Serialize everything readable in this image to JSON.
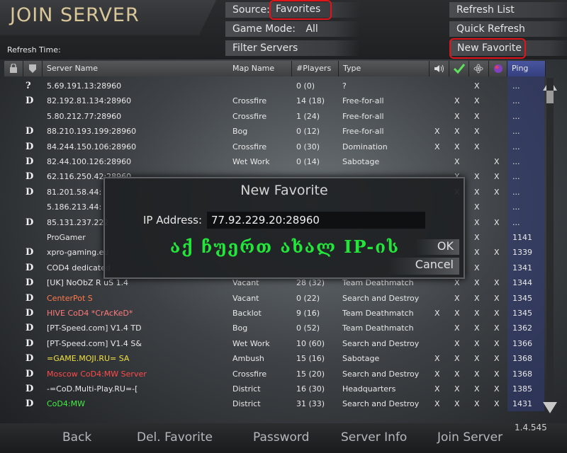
{
  "header": {
    "title": "JOIN SERVER",
    "source_label": "Source:",
    "source_value": "Favorites",
    "game_mode_label": "Game Mode:",
    "game_mode_value": "All",
    "filter_servers": "Filter Servers",
    "refresh_time": "Refresh Time:",
    "refresh_list": "Refresh List",
    "quick_refresh": "Quick Refresh",
    "new_favorite": "New Favorite"
  },
  "columns": {
    "server_name": "Server Name",
    "map_name": "Map Name",
    "players": "#Players",
    "type": "Type",
    "ping": "Ping"
  },
  "rows": [
    {
      "icon": "?",
      "name": "5.69.191.13:28960",
      "map": "",
      "players": "0 (0)",
      "type": "?",
      "c1": "",
      "c2": "",
      "c3": "X",
      "c4": "",
      "ping": "...",
      "color": "#e8e8e8"
    },
    {
      "icon": "D",
      "name": "82.192.81.134:28960",
      "map": "Crossfire",
      "players": "14 (18)",
      "type": "Free-for-all",
      "c1": "",
      "c2": "X",
      "c3": "X",
      "c4": "",
      "ping": "...",
      "color": "#e8e8e8"
    },
    {
      "icon": "",
      "name": "5.80.212.77:28960",
      "map": "Crossfire",
      "players": "1 (24)",
      "type": "Free-for-all",
      "c1": "",
      "c2": "X",
      "c3": "X",
      "c4": "",
      "ping": "...",
      "color": "#e8e8e8"
    },
    {
      "icon": "D",
      "name": "88.210.193.199:28960",
      "map": "Bog",
      "players": "0 (12)",
      "type": "Free-for-all",
      "c1": "X",
      "c2": "X",
      "c3": "X",
      "c4": "",
      "ping": "...",
      "color": "#e8e8e8"
    },
    {
      "icon": "D",
      "name": "84.244.150.106:28960",
      "map": "Crossfire",
      "players": "0 (30)",
      "type": "Domination",
      "c1": "X",
      "c2": "X",
      "c3": "X",
      "c4": "",
      "ping": "...",
      "color": "#e8e8e8"
    },
    {
      "icon": "D",
      "name": "82.44.100.126:28960",
      "map": "Wet Work",
      "players": "0 (14)",
      "type": "Sabotage",
      "c1": "",
      "c2": "X",
      "c3": "",
      "c4": "X",
      "ping": "...",
      "color": "#e8e8e8"
    },
    {
      "icon": "D",
      "name": "62.116.250.42:28960",
      "map": "",
      "players": "",
      "type": "",
      "c1": "",
      "c2": "X",
      "c3": "X",
      "c4": "X",
      "ping": "...",
      "color": "#e8e8e8"
    },
    {
      "icon": "D",
      "name": "81.201.58.44:",
      "map": "",
      "players": "",
      "type": "",
      "c1": "",
      "c2": "X",
      "c3": "X",
      "c4": "X",
      "ping": "...",
      "color": "#e8e8e8"
    },
    {
      "icon": "",
      "name": "5.186.213.44:",
      "map": "",
      "players": "",
      "type": "",
      "c1": "",
      "c2": "",
      "c3": "X",
      "c4": "",
      "ping": "...",
      "color": "#e8e8e8"
    },
    {
      "icon": "D",
      "name": "85.131.237.222",
      "map": "",
      "players": "",
      "type": "",
      "c1": "",
      "c2": "",
      "c3": "X",
      "c4": "X",
      "ping": "...",
      "color": "#e8e8e8"
    },
    {
      "icon": "",
      "name": "ProGamer",
      "map": "",
      "players": "",
      "type": "",
      "c1": "",
      "c2": "",
      "c3": "X",
      "c4": "",
      "ping": "1141",
      "color": "#e8e8e8"
    },
    {
      "icon": "D",
      "name": "xpro-gaming.eu",
      "map": "",
      "players": "",
      "type": "",
      "c1": "",
      "c2": "",
      "c3": "X",
      "c4": "X",
      "ping": "1339",
      "color": "#e8e8e8"
    },
    {
      "icon": "D",
      "name": "COD4 dedicated",
      "map": "",
      "players": "",
      "type": "",
      "c1": "",
      "c2": "",
      "c3": "X",
      "c4": "",
      "ping": "1341",
      "color": "#e8e8e8"
    },
    {
      "icon": "D",
      "name": "[UK] NoObZ R uS 1.4",
      "map": "Vacant",
      "players": "28 (32)",
      "type": "Team Deathmatch",
      "c1": "",
      "c2": "X",
      "c3": "X",
      "c4": "X",
      "ping": "1344",
      "color": "#e8e8e8"
    },
    {
      "icon": "D",
      "name": "CenterPot S",
      "map": "Vacant",
      "players": "0 (22)",
      "type": "Search and Destroy",
      "c1": "",
      "c2": "X",
      "c3": "X",
      "c4": "X",
      "ping": "1345",
      "color": "#ff7a4a"
    },
    {
      "icon": "D",
      "name": "HIVE CoD4 *CrAcKeD*",
      "map": "Backlot",
      "players": "9 (16)",
      "type": "Team Deathmatch",
      "c1": "X",
      "c2": "X",
      "c3": "X",
      "c4": "X",
      "ping": "1345",
      "color": "#ff7a7a"
    },
    {
      "icon": "D",
      "name": "[PT-Speed.com] V1.4 TD",
      "map": "Bog",
      "players": "0 (52)",
      "type": "Team Deathmatch",
      "c1": "",
      "c2": "X",
      "c3": "X",
      "c4": "X",
      "ping": "1362",
      "color": "#e8e8e8"
    },
    {
      "icon": "D",
      "name": "[PT-Speed.com] V1.4 S&",
      "map": "Wet Work",
      "players": "10 (60)",
      "type": "Search and Destroy",
      "c1": "",
      "c2": "X",
      "c3": "X",
      "c4": "X",
      "ping": "1366",
      "color": "#e8e8e8"
    },
    {
      "icon": "D",
      "name": "=GAME.MOJI.RU= SA",
      "map": "Ambush",
      "players": "15 (16)",
      "type": "Sabotage",
      "c1": "X",
      "c2": "X",
      "c3": "X",
      "c4": "X",
      "ping": "1368",
      "color": "#f0e040"
    },
    {
      "icon": "D",
      "name": "Moscow CoD4:MW Server",
      "map": "Crossfire",
      "players": "15 (20)",
      "type": "Search and Destroy",
      "c1": "X",
      "c2": "X",
      "c3": "X",
      "c4": "X",
      "ping": "1368",
      "color": "#ff4a4a"
    },
    {
      "icon": "D",
      "name": "-=CoD.Multi-Play.RU=-[",
      "map": "District",
      "players": "16 (30)",
      "type": "Headquarters",
      "c1": "X",
      "c2": "X",
      "c3": "X",
      "c4": "X",
      "ping": "1385",
      "color": "#e8e8e8"
    },
    {
      "icon": "D",
      "name": "CoD4:MW",
      "map": "District",
      "players": "31 (33)",
      "type": "Search and Destroy",
      "c1": "X",
      "c2": "X",
      "c3": "X",
      "c4": "X",
      "ping": "1431",
      "color": "#44ee44"
    }
  ],
  "dialog": {
    "title": "New Favorite",
    "ip_label": "IP Address:",
    "ip_value": "77.92.229.20:28960",
    "note": "აქ ჩუერთ ახალ IP-ის",
    "ok": "OK",
    "cancel": "Cancel"
  },
  "footer": {
    "back": "Back",
    "del_favorite": "Del. Favorite",
    "password": "Password",
    "server_info": "Server Info",
    "join_server": "Join Server",
    "version": "1.4.545"
  },
  "colors": {
    "accent_red": "#e0141a",
    "title_gold": "#d9c79a",
    "note_green": "#22e63a",
    "ping_column": "#323c78"
  }
}
